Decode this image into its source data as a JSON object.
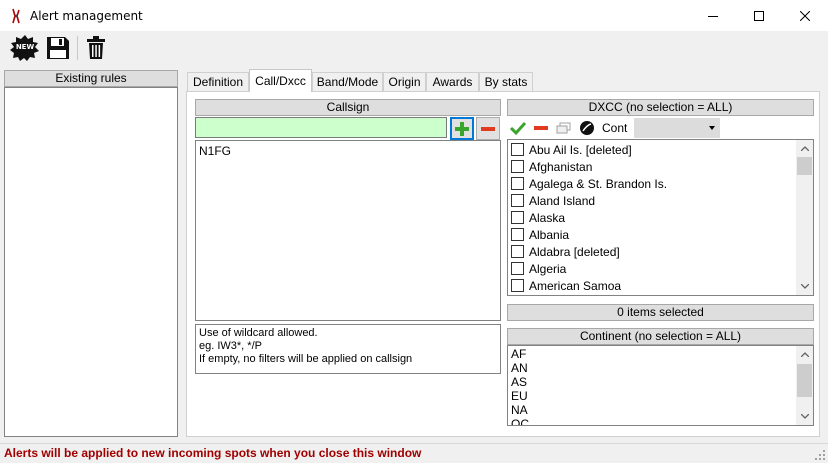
{
  "window": {
    "title": "Alert management"
  },
  "toolbar": {
    "new_label": "NEW"
  },
  "left_panel": {
    "header": "Existing rules"
  },
  "tabs": [
    {
      "label": "Definition"
    },
    {
      "label": "Call/Dxcc"
    },
    {
      "label": "Band/Mode"
    },
    {
      "label": "Origin"
    },
    {
      "label": "Awards"
    },
    {
      "label": "By stats"
    }
  ],
  "callsign": {
    "header": "Callsign",
    "input_value": "",
    "list": [
      "N1FG"
    ],
    "hint_lines": [
      "Use of wildcard allowed.",
      "eg. IW3*, */P",
      "If empty, no filters will be applied on callsign"
    ]
  },
  "dxcc": {
    "header": "DXCC (no selection = ALL)",
    "cont_label": "Cont",
    "cont_value": "",
    "items": [
      "Abu Ail Is. [deleted]",
      "Afghanistan",
      "Agalega & St. Brandon Is.",
      "Aland Island",
      "Alaska",
      "Albania",
      "Aldabra [deleted]",
      "Algeria",
      "American Samoa"
    ],
    "selected_count": "0 items selected"
  },
  "continent": {
    "header": "Continent (no selection = ALL)",
    "items": [
      "AF",
      "AN",
      "AS",
      "EU",
      "NA",
      "OC"
    ]
  },
  "status": {
    "message": "Alerts will be applied to new incoming spots when you close this window"
  },
  "colors": {
    "callsign_input_bg": "#ccffcc",
    "status_text": "#a00000",
    "focus_border": "#0078d7"
  }
}
